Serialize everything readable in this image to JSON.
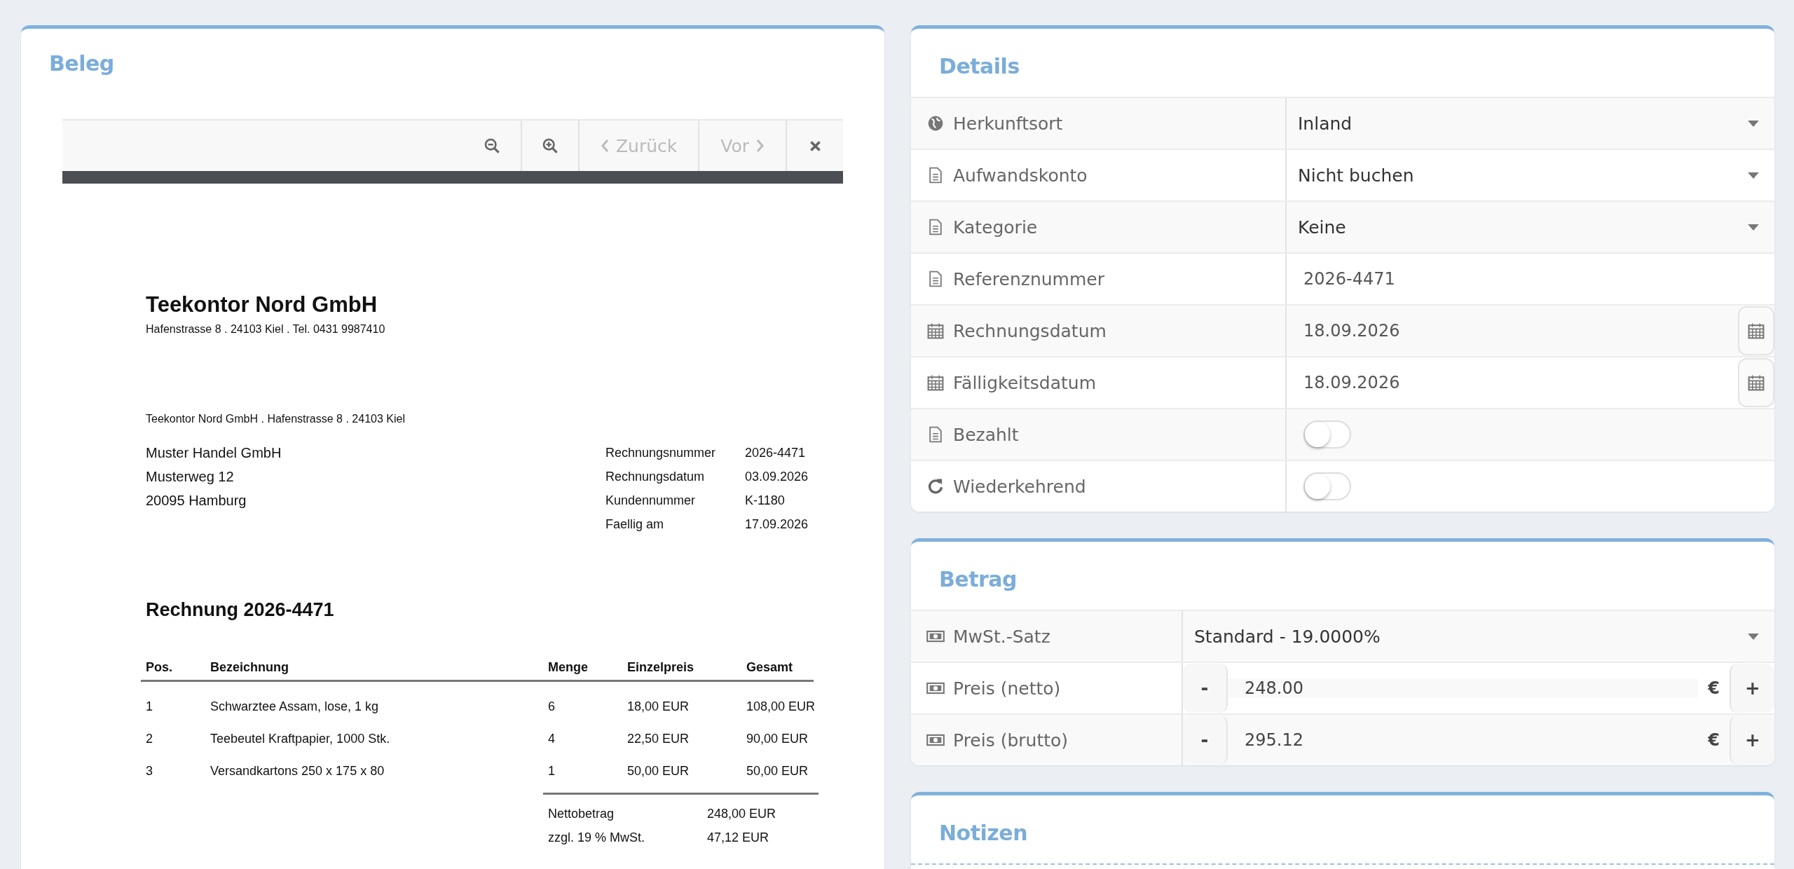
{
  "beleg": {
    "title": "Beleg",
    "toolbar": [
      {
        "kind": "zoom-out",
        "disabled": false
      },
      {
        "kind": "zoom-in",
        "disabled": false
      },
      {
        "kind": "prev",
        "label": "Zurück",
        "disabled": true
      },
      {
        "kind": "next",
        "label": "Vor",
        "disabled": true
      },
      {
        "kind": "close",
        "disabled": false
      }
    ],
    "document": {
      "company": "Teekontor Nord GmbH",
      "company_address": "Hafenstrasse 8 . 24103 Kiel . Tel. 0431 9987410",
      "sender_line": "Teekontor Nord GmbH . Hafenstrasse 8 . 24103 Kiel",
      "recipient": [
        "Muster Handel GmbH",
        "Musterweg 12",
        "20095 Hamburg"
      ],
      "meta": [
        {
          "label": "Rechnungsnummer",
          "value": "2026-4471"
        },
        {
          "label": "Rechnungsdatum",
          "value": "03.09.2026"
        },
        {
          "label": "Kundennummer",
          "value": "K-1180"
        },
        {
          "label": "Faellig am",
          "value": "17.09.2026"
        }
      ],
      "heading": "Rechnung 2026-4471",
      "columns": [
        "Pos.",
        "Bezeichnung",
        "Menge",
        "Einzelpreis",
        "Gesamt"
      ],
      "rows": [
        [
          "1",
          "Schwarztee Assam, lose, 1 kg",
          "6",
          "18,00 EUR",
          "108,00 EUR"
        ],
        [
          "2",
          "Teebeutel Kraftpapier, 1000 Stk.",
          "4",
          "22,50 EUR",
          "90,00 EUR"
        ],
        [
          "3",
          "Versandkartons 250 x 175 x 80",
          "1",
          "50,00 EUR",
          "50,00 EUR"
        ]
      ],
      "totals": [
        {
          "label": "Nettobetrag",
          "value": "248,00 EUR"
        },
        {
          "label": "zzgl. 19 % MwSt.",
          "value": "47,12 EUR"
        }
      ]
    }
  },
  "details": {
    "title": "Details",
    "rows": [
      {
        "label": "Herkunftsort",
        "kind": "select",
        "value": "Inland"
      },
      {
        "label": "Aufwandskonto",
        "kind": "select",
        "value": "Nicht buchen"
      },
      {
        "label": "Kategorie",
        "kind": "select",
        "value": "Keine"
      },
      {
        "label": "Referenznummer",
        "kind": "text",
        "value": "2026-4471"
      },
      {
        "label": "Rechnungsdatum",
        "kind": "date",
        "value": "18.09.2026"
      },
      {
        "label": "Fälligkeitsdatum",
        "kind": "date",
        "value": "18.09.2026"
      },
      {
        "label": "Bezahlt",
        "kind": "toggle",
        "on": false
      },
      {
        "label": "Wiederkehrend",
        "kind": "toggle",
        "on": false
      }
    ]
  },
  "betrag": {
    "title": "Betrag",
    "rows": [
      {
        "label": "MwSt.-Satz",
        "kind": "select",
        "value": "Standard - 19.0000%"
      },
      {
        "label": "Preis (netto)",
        "kind": "number",
        "minus": "-",
        "value": "248.00",
        "currency": "€",
        "plus": "+"
      },
      {
        "label": "Preis (brutto)",
        "kind": "number",
        "minus": "-",
        "value": "295.12",
        "currency": "€",
        "plus": "+"
      }
    ]
  },
  "notizen": {
    "title": "Notizen"
  }
}
